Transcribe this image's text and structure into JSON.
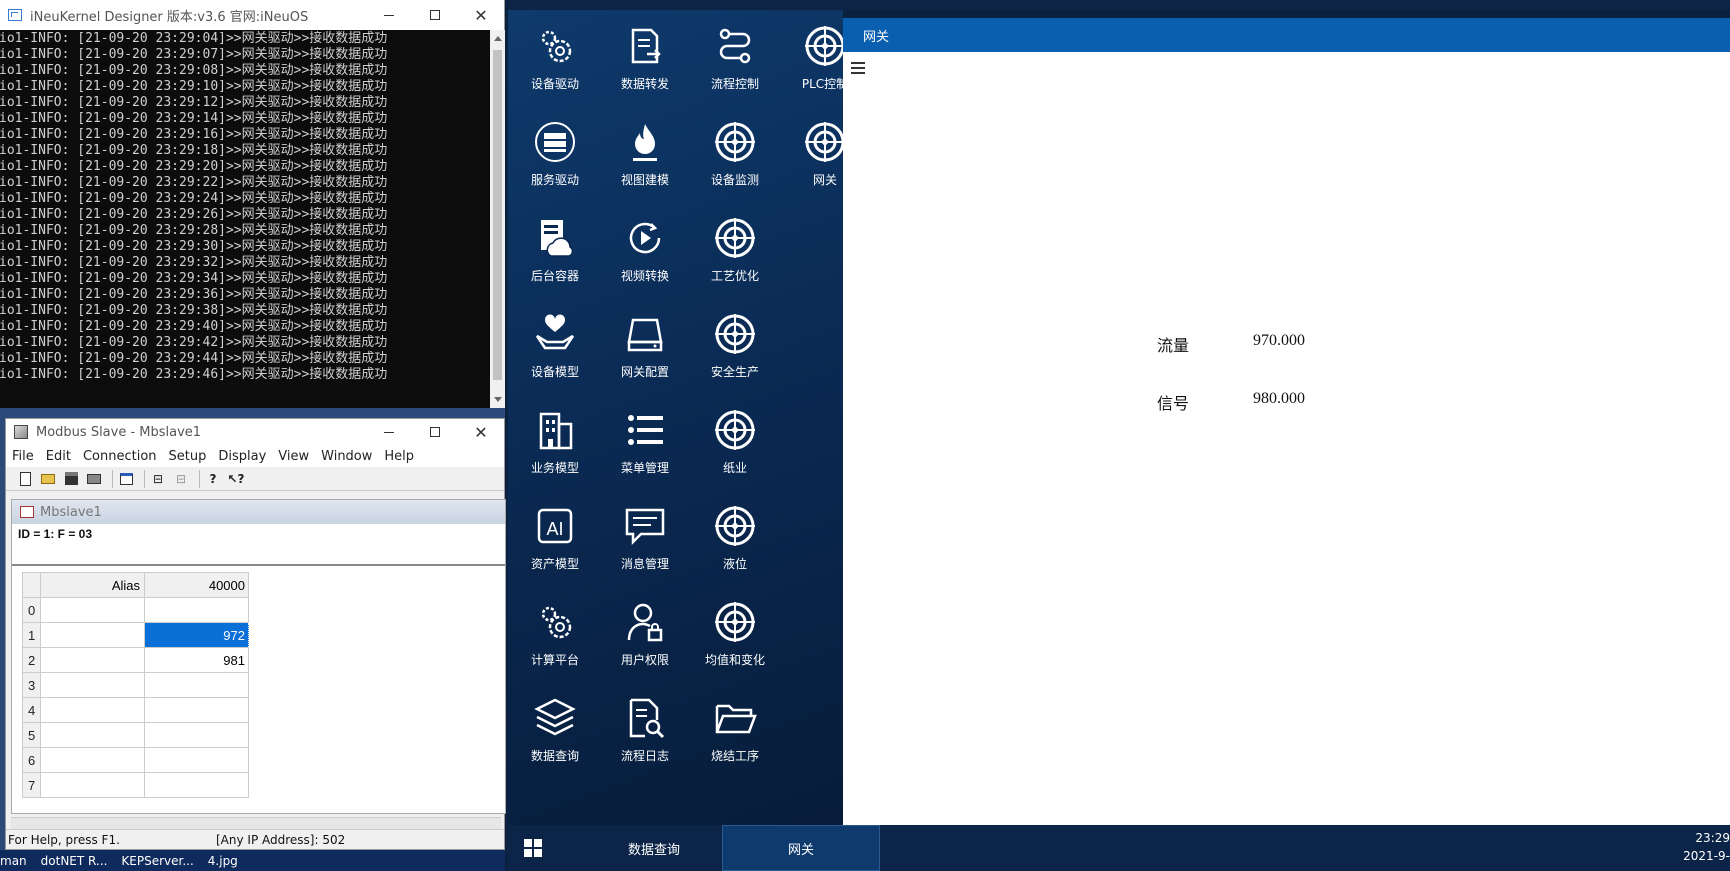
{
  "console": {
    "title": "iNeuKernel Designer 版本:v3.6 官网:iNeuOS",
    "lines": [
      "io1-INFO: [21-09-20 23:29:04]>>网关驱动>>接收数据成功",
      "io1-INFO: [21-09-20 23:29:07]>>网关驱动>>接收数据成功",
      "io1-INFO: [21-09-20 23:29:08]>>网关驱动>>接收数据成功",
      "io1-INFO: [21-09-20 23:29:10]>>网关驱动>>接收数据成功",
      "io1-INFO: [21-09-20 23:29:12]>>网关驱动>>接收数据成功",
      "io1-INFO: [21-09-20 23:29:14]>>网关驱动>>接收数据成功",
      "io1-INFO: [21-09-20 23:29:16]>>网关驱动>>接收数据成功",
      "io1-INFO: [21-09-20 23:29:18]>>网关驱动>>接收数据成功",
      "io1-INFO: [21-09-20 23:29:20]>>网关驱动>>接收数据成功",
      "io1-INFO: [21-09-20 23:29:22]>>网关驱动>>接收数据成功",
      "io1-INFO: [21-09-20 23:29:24]>>网关驱动>>接收数据成功",
      "io1-INFO: [21-09-20 23:29:26]>>网关驱动>>接收数据成功",
      "io1-INFO: [21-09-20 23:29:28]>>网关驱动>>接收数据成功",
      "io1-INFO: [21-09-20 23:29:30]>>网关驱动>>接收数据成功",
      "io1-INFO: [21-09-20 23:29:32]>>网关驱动>>接收数据成功",
      "io1-INFO: [21-09-20 23:29:34]>>网关驱动>>接收数据成功",
      "io1-INFO: [21-09-20 23:29:36]>>网关驱动>>接收数据成功",
      "io1-INFO: [21-09-20 23:29:38]>>网关驱动>>接收数据成功",
      "io1-INFO: [21-09-20 23:29:40]>>网关驱动>>接收数据成功",
      "io1-INFO: [21-09-20 23:29:42]>>网关驱动>>接收数据成功",
      "io1-INFO: [21-09-20 23:29:44]>>网关驱动>>接收数据成功",
      "io1-INFO: [21-09-20 23:29:46]>>网关驱动>>接收数据成功"
    ]
  },
  "modbus": {
    "title": "Modbus Slave - Mbslave1",
    "menu": [
      "File",
      "Edit",
      "Connection",
      "Setup",
      "Display",
      "View",
      "Window",
      "Help"
    ],
    "child_title": "Mbslave1",
    "id_line": "ID = 1: F = 03",
    "grid": {
      "alias_header": "Alias",
      "address_header": "40000",
      "rows": [
        {
          "index": "0",
          "value": ""
        },
        {
          "index": "1",
          "value": "972"
        },
        {
          "index": "2",
          "value": "981"
        },
        {
          "index": "3",
          "value": ""
        },
        {
          "index": "4",
          "value": ""
        },
        {
          "index": "5",
          "value": ""
        },
        {
          "index": "6",
          "value": ""
        },
        {
          "index": "7",
          "value": ""
        }
      ],
      "selected_row": 1
    },
    "status_help": "For Help, press F1.",
    "status_addr": "[Any IP Address]: 502"
  },
  "left_taskbar": [
    "man",
    "dotNET R...",
    "KEPServer...",
    "4.jpg"
  ],
  "apps": [
    {
      "label": "设备驱动",
      "icon": "gears-icon"
    },
    {
      "label": "数据转发",
      "icon": "doc-export-icon"
    },
    {
      "label": "流程控制",
      "icon": "flow-icon"
    },
    {
      "label": "PLC控制",
      "icon": "radar-icon"
    },
    {
      "label": "服务驱动",
      "icon": "server-icon"
    },
    {
      "label": "视图建模",
      "icon": "flame-icon"
    },
    {
      "label": "设备监测",
      "icon": "radar-icon"
    },
    {
      "label": "网关",
      "icon": "radar-icon"
    },
    {
      "label": "后台容器",
      "icon": "cloud-server-icon"
    },
    {
      "label": "视频转换",
      "icon": "play-cycle-icon"
    },
    {
      "label": "工艺优化",
      "icon": "radar-icon"
    },
    {
      "label": "设备模型",
      "icon": "hand-heart-icon"
    },
    {
      "label": "网关配置",
      "icon": "drive-icon"
    },
    {
      "label": "安全生产",
      "icon": "radar-icon"
    },
    {
      "label": "业务模型",
      "icon": "building-icon"
    },
    {
      "label": "菜单管理",
      "icon": "list-icon"
    },
    {
      "label": "纸业",
      "icon": "radar-icon"
    },
    {
      "label": "资产模型",
      "icon": "ai-icon"
    },
    {
      "label": "消息管理",
      "icon": "message-icon"
    },
    {
      "label": "液位",
      "icon": "radar-icon"
    },
    {
      "label": "计算平台",
      "icon": "gears-icon"
    },
    {
      "label": "用户权限",
      "icon": "user-lock-icon"
    },
    {
      "label": "均值和变化",
      "icon": "radar-icon"
    },
    {
      "label": "数据查询",
      "icon": "layers-icon"
    },
    {
      "label": "流程日志",
      "icon": "doc-search-icon"
    },
    {
      "label": "烧结工序",
      "icon": "folder-open-icon"
    }
  ],
  "content": {
    "header": "网关",
    "flow_label": "流量",
    "flow_value": "970.000",
    "signal_label": "信号",
    "signal_value": "980.000"
  },
  "taskbar": {
    "item1": "数据查询",
    "item2": "网关",
    "time": "23:29",
    "date": "2021-9-"
  },
  "colors": {
    "header_blue": "#0a5fb0",
    "selected_cell": "#0a6fd6"
  }
}
